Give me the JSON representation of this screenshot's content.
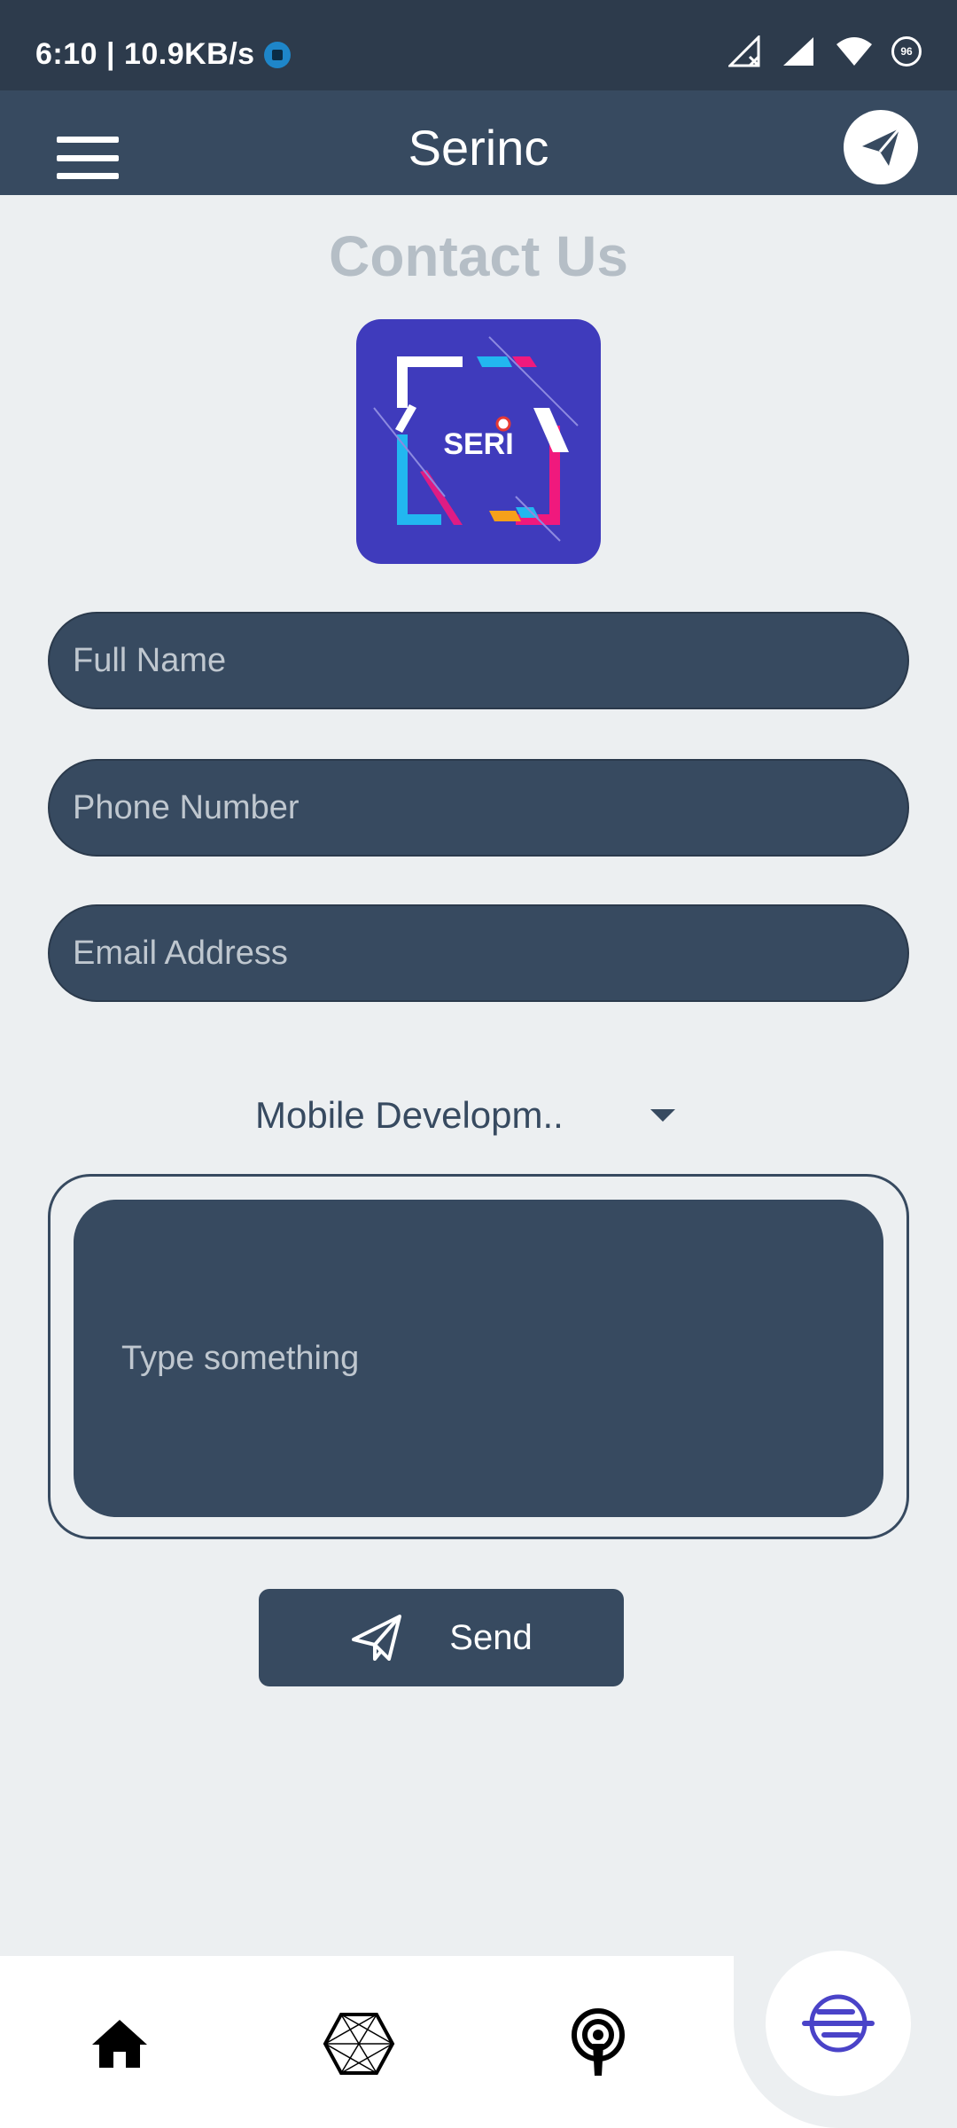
{
  "status_bar": {
    "time_speed": "6:10 | 10.9KB/s",
    "battery": "96"
  },
  "app_bar": {
    "title": "Serinc",
    "menu_icon": "hamburger-menu-icon",
    "action_icon": "paper-plane-icon"
  },
  "page": {
    "title": "Contact Us",
    "logo_text": "SERI"
  },
  "form": {
    "full_name_placeholder": "Full Name",
    "phone_placeholder": "Phone Number",
    "email_placeholder": "Email Address",
    "service_selected": "Mobile Developm..",
    "message_placeholder": "Type something",
    "send_label": "Send"
  },
  "bottom_nav": {
    "items": [
      "home-icon",
      "hexagon-network-icon",
      "podcast-icon",
      "serinc-logo-icon"
    ],
    "active": "serinc-logo-icon"
  },
  "colors": {
    "primary": "#374A60",
    "status_bar": "#2D3B4C",
    "background": "#ECEFF1",
    "title_muted": "#B5BEC6",
    "logo_bg": "#3F3BBC"
  }
}
